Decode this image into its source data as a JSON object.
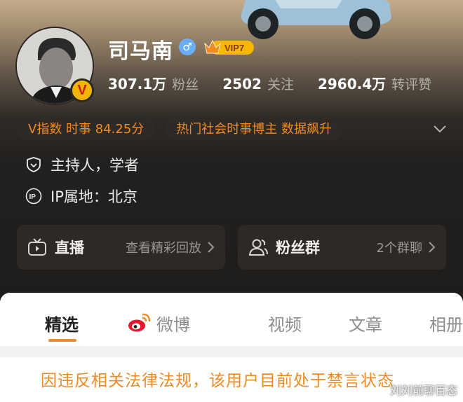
{
  "profile": {
    "name": "司马南",
    "gender_icon": "male-icon",
    "vip_label": "VIP7",
    "avatar_badge": "V"
  },
  "stats": [
    {
      "num": "307.1万",
      "label": "粉丝"
    },
    {
      "num": "2502",
      "label": "关注"
    },
    {
      "num": "2960.4万",
      "label": "转评赞"
    }
  ],
  "chips": [
    "V指数 时事 84.25分",
    "热门社会时事博主 数据飙升"
  ],
  "info": {
    "occupation": "主持人，学者",
    "ip_location": "IP属地：北京"
  },
  "cards": {
    "live": {
      "title": "直播",
      "sub": "查看精彩回放"
    },
    "fans": {
      "title": "粉丝群",
      "sub": "2个群聊"
    }
  },
  "tabs": [
    "精选",
    "微博",
    "视频",
    "文章",
    "相册"
  ],
  "ban_notice": "因违反相关法律法规，该用户目前处于禁言状态",
  "watermark": "刘刘前聊百态",
  "colors": {
    "accent": "#f08a24",
    "vip_gold": "#f2b705",
    "gender_blue": "#6aaef5"
  }
}
